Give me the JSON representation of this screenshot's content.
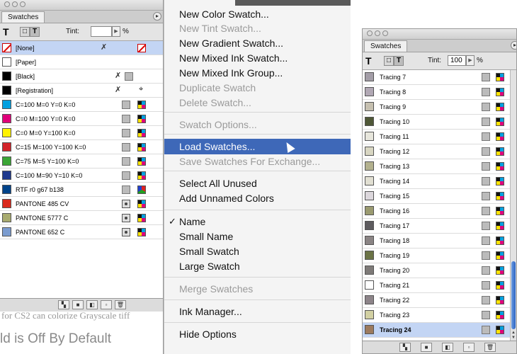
{
  "left_panel": {
    "tab": "Swatches",
    "tint_label": "Tint:",
    "tint_value": "",
    "pct": "%",
    "swatches": [
      {
        "name": "[None]",
        "color": "#ffffff",
        "type": "none",
        "selected": true
      },
      {
        "name": "[Paper]",
        "color": "#ffffff",
        "type": "plain"
      },
      {
        "name": "[Black]",
        "color": "#000000",
        "type": "black"
      },
      {
        "name": "[Registration]",
        "color": "#000000",
        "type": "registration"
      },
      {
        "name": "C=100 M=0 Y=0 K=0",
        "color": "#00a0e0",
        "type": "process"
      },
      {
        "name": "C=0 M=100 Y=0 K=0",
        "color": "#e0007a",
        "type": "process"
      },
      {
        "name": "C=0 M=0 Y=100 K=0",
        "color": "#fff200",
        "type": "process"
      },
      {
        "name": "C=15 M=100 Y=100 K=0",
        "color": "#d2232a",
        "type": "process"
      },
      {
        "name": "C=75 M=5 Y=100 K=0",
        "color": "#3aa535",
        "type": "process"
      },
      {
        "name": "C=100 M=90 Y=10 K=0",
        "color": "#203a8e",
        "type": "process"
      },
      {
        "name": "RTF r0 g67 b138",
        "color": "#00438a",
        "type": "rgb"
      },
      {
        "name": "PANTONE 485 CV",
        "color": "#da291c",
        "type": "spot"
      },
      {
        "name": "PANTONE 5777 C",
        "color": "#a8ab6f",
        "type": "spot"
      },
      {
        "name": "PANTONE 652 C",
        "color": "#7b9ccf",
        "type": "spot"
      }
    ]
  },
  "background_text": {
    "line1": "for CS2 can colorize Grayscale tiff",
    "line2": "ld is Off By Default"
  },
  "menu": {
    "items": [
      {
        "label": "New Color Swatch...",
        "state": "enabled"
      },
      {
        "label": "New Tint Swatch...",
        "state": "disabled"
      },
      {
        "label": "New Gradient Swatch...",
        "state": "enabled"
      },
      {
        "label": "New Mixed Ink Swatch...",
        "state": "enabled"
      },
      {
        "label": "New Mixed Ink Group...",
        "state": "enabled"
      },
      {
        "label": "Duplicate Swatch",
        "state": "disabled"
      },
      {
        "label": "Delete Swatch...",
        "state": "disabled"
      },
      {
        "label": "Swatch Options...",
        "state": "disabled"
      },
      {
        "label": "Load Swatches...",
        "state": "highlighted"
      },
      {
        "label": "Save Swatches For Exchange...",
        "state": "disabled"
      },
      {
        "label": "Select All Unused",
        "state": "enabled"
      },
      {
        "label": "Add Unnamed Colors",
        "state": "enabled"
      },
      {
        "label": "Name",
        "state": "checked"
      },
      {
        "label": "Small Name",
        "state": "enabled"
      },
      {
        "label": "Small Swatch",
        "state": "enabled"
      },
      {
        "label": "Large Swatch",
        "state": "enabled"
      },
      {
        "label": "Merge Swatches",
        "state": "disabled"
      },
      {
        "label": "Ink Manager...",
        "state": "enabled"
      },
      {
        "label": "Hide Options",
        "state": "enabled"
      }
    ],
    "checkmark": "✓"
  },
  "right_panel": {
    "tab": "Swatches",
    "tint_label": "Tint:",
    "tint_value": "100",
    "pct": "%",
    "swatches": [
      {
        "name": "Tracing 7",
        "color": "#a39da7"
      },
      {
        "name": "Tracing 8",
        "color": "#b1a8b4"
      },
      {
        "name": "Tracing 9",
        "color": "#c6c0b0"
      },
      {
        "name": "Tracing 10",
        "color": "#4e5736"
      },
      {
        "name": "Tracing 11",
        "color": "#e7e6dc"
      },
      {
        "name": "Tracing 12",
        "color": "#d8d6c2"
      },
      {
        "name": "Tracing 13",
        "color": "#b3b18e"
      },
      {
        "name": "Tracing 14",
        "color": "#e1dfd2"
      },
      {
        "name": "Tracing 15",
        "color": "#dcd7dc"
      },
      {
        "name": "Tracing 16",
        "color": "#9a9a70"
      },
      {
        "name": "Tracing 17",
        "color": "#5e5c5f"
      },
      {
        "name": "Tracing 18",
        "color": "#8a8484"
      },
      {
        "name": "Tracing 19",
        "color": "#6b7346"
      },
      {
        "name": "Tracing 20",
        "color": "#7e7a78"
      },
      {
        "name": "Tracing 21",
        "color": "#ffffff"
      },
      {
        "name": "Tracing 22",
        "color": "#8d8489"
      },
      {
        "name": "Tracing 23",
        "color": "#d2d0a3"
      },
      {
        "name": "Tracing 24",
        "color": "#9c7a5e",
        "selected": true
      }
    ]
  }
}
